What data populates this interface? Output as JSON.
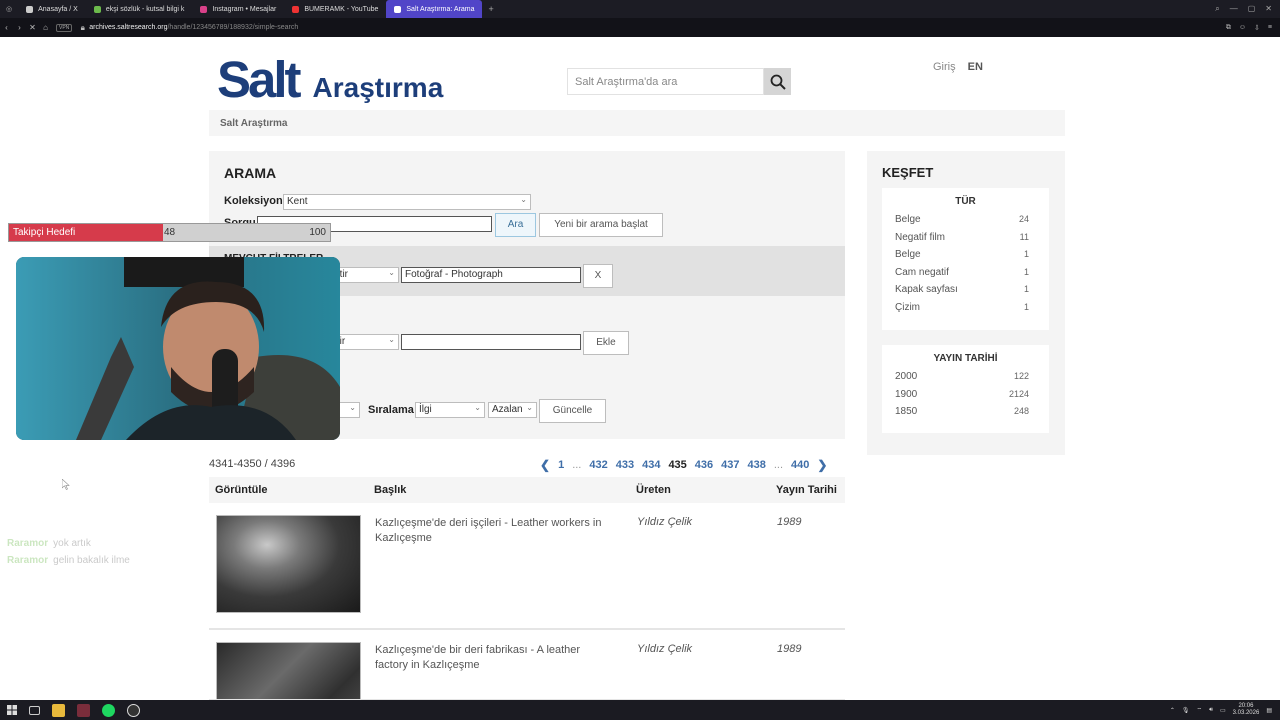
{
  "browser": {
    "tabs": [
      {
        "label": "Anasayfa / X",
        "color": "#cccccc",
        "active": false
      },
      {
        "label": "ekşi sözlük - kutsal bilgi k",
        "color": "#6cba4c",
        "active": false
      },
      {
        "label": "Instagram • Mesajlar",
        "color": "#d9418a",
        "active": false
      },
      {
        "label": "BUMERAMK - YouTube",
        "color": "#e33",
        "active": false
      },
      {
        "label": "Salt Araştırma: Arama",
        "color": "#5145c8",
        "active": true
      }
    ],
    "new_tab": "+",
    "vpn": "VPN",
    "url_host": "archives.saltresearch.org",
    "url_path": "/handle/123456789/188932/simple-search"
  },
  "header": {
    "logo_salt": "Salt",
    "logo_arastirma": "Araştırma",
    "search_placeholder": "Salt Araştırma'da ara",
    "login": "Giriş",
    "lang": "EN"
  },
  "breadcrumb": "Salt Araştırma",
  "search": {
    "title": "ARAMA",
    "collection_label": "Koleksiyon",
    "collection_value": "Kent",
    "query_label": "Sorgu",
    "query_value": "",
    "search_button": "Ara",
    "new_search_button": "Yeni bir arama başlat",
    "filters_label": "MEVCUT FİLTRELER",
    "filter_op": "Eşittir",
    "filter_value": "Fotoğraf - Photograph",
    "remove_button": "X",
    "add_op": "İçerir",
    "add_value": "",
    "add_button": "Ekle",
    "sort_label": "Sıralama",
    "sort_by": "İlgi",
    "sort_order": "Azalan",
    "update_button": "Güncelle"
  },
  "results": {
    "count_text": "4341-4350 / 4396",
    "pages": [
      "1",
      "...",
      "432",
      "433",
      "434",
      "435",
      "436",
      "437",
      "438",
      "...",
      "440"
    ],
    "current_page": "435",
    "columns": {
      "view": "Görüntüle",
      "title": "Başlık",
      "creator": "Üreten",
      "date": "Yayın Tarihi"
    },
    "rows": [
      {
        "title": "Kazlıçeşme'de deri işçileri - Leather workers in Kazlıçeşme",
        "creator": "Yıldız Çelik",
        "date": "1989"
      },
      {
        "title": "Kazlıçeşme'de bir deri fabrikası - A leather factory in Kazlıçeşme",
        "creator": "Yıldız Çelik",
        "date": "1989"
      }
    ]
  },
  "discover": {
    "title": "KEŞFET",
    "type_title": "TÜR",
    "types": [
      {
        "label": "Belge",
        "count": "24"
      },
      {
        "label": "Negatif film",
        "count": "11"
      },
      {
        "label": "Belge",
        "count": "1"
      },
      {
        "label": "Cam negatif",
        "count": "1"
      },
      {
        "label": "Kapak sayfası",
        "count": "1"
      },
      {
        "label": "Çizim",
        "count": "1"
      }
    ],
    "date_title": "YAYIN TARİHİ",
    "dates": [
      {
        "label": "2000",
        "count": "122"
      },
      {
        "label": "1900",
        "count": "2124"
      },
      {
        "label": "1850",
        "count": "248"
      }
    ]
  },
  "overlay": {
    "goal_label": "Takipçi Hedefi",
    "goal_current": "48",
    "goal_max": "100",
    "goal_fraction": 0.48,
    "chat": [
      {
        "user": "Raramor",
        "msg": "yok artık"
      },
      {
        "user": "Raramor",
        "msg": "gelin bakalık ilme"
      }
    ]
  },
  "taskbar": {
    "time": "20:06",
    "date": "3.03.2026"
  }
}
